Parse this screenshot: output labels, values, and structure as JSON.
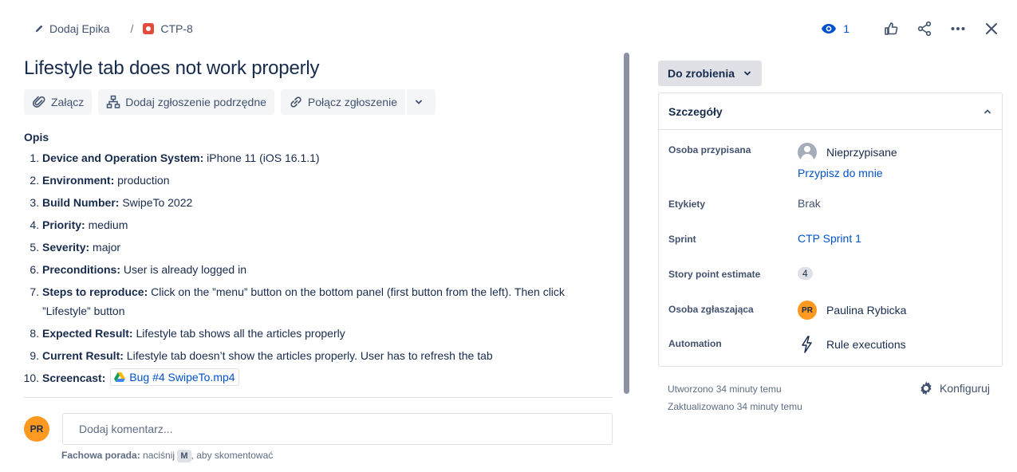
{
  "breadcrumb": {
    "add_epic": "Dodaj Epika",
    "separator": "/",
    "issue_key": "CTP-8"
  },
  "header_actions": {
    "watchers_count": "1",
    "icons": [
      "eye-icon",
      "thumbs-up-icon",
      "share-icon",
      "more-icon",
      "close-icon"
    ]
  },
  "issue": {
    "title": "Lifestyle tab does not work properly",
    "actions": {
      "attach": "Załącz",
      "add_child": "Dodaj zgłoszenie podrzędne",
      "link_issue": "Połącz zgłoszenie"
    },
    "description_label": "Opis",
    "description_items": [
      {
        "label": "Device and Operation System:",
        "text": " iPhone 11 (iOS 16.1.1)"
      },
      {
        "label": "Environment:",
        "text": " production"
      },
      {
        "label": "Build Number:",
        "text": " SwipeTo 2022"
      },
      {
        "label": "Priority:",
        "text": " medium"
      },
      {
        "label": "Severity:",
        "text": " major"
      },
      {
        "label": "Preconditions:",
        "text": " User is already logged in"
      },
      {
        "label": "Steps to reproduce:",
        "text": " Click on the ”menu” button on the bottom panel (first button from the left). Then click ”Lifestyle” button"
      },
      {
        "label": "Expected Result:",
        "text": " Lifestyle tab shows all the articles properly"
      },
      {
        "label": "Current Result:",
        "text": " Lifestyle tab doesn’t show the articles properly. User has to refresh the tab"
      },
      {
        "label": "Screencast:",
        "text": ""
      }
    ],
    "screencast_file": "Bug #4 SwipeTo.mp4"
  },
  "comment": {
    "avatar_initials": "PR",
    "placeholder": "Dodaj komentarz...",
    "tip_label": "Fachowa porada:",
    "tip_text": " naciśnij ",
    "tip_key": "M",
    "tip_suffix": ", aby skomentować"
  },
  "status": {
    "label": "Do zrobienia"
  },
  "details": {
    "title": "Szczegóły",
    "assignee_label": "Osoba przypisana",
    "assignee_value": "Nieprzypisane",
    "assign_to_me": "Przypisz do mnie",
    "labels_label": "Etykiety",
    "labels_value": "Brak",
    "sprint_label": "Sprint",
    "sprint_value": "CTP Sprint 1",
    "story_points_label": "Story point estimate",
    "story_points_value": "4",
    "reporter_label": "Osoba zgłaszająca",
    "reporter_initials": "PR",
    "reporter_name": "Paulina Rybicka",
    "automation_label": "Automation",
    "automation_value": "Rule executions"
  },
  "meta": {
    "created": "Utworzono 34 minuty temu",
    "updated": "Zaktualizowano 34 minuty temu",
    "configure": "Konfiguruj"
  },
  "colors": {
    "link": "#0052cc",
    "bug": "#e5493a",
    "avatar": "#ff991f",
    "text": "#172b4d"
  }
}
